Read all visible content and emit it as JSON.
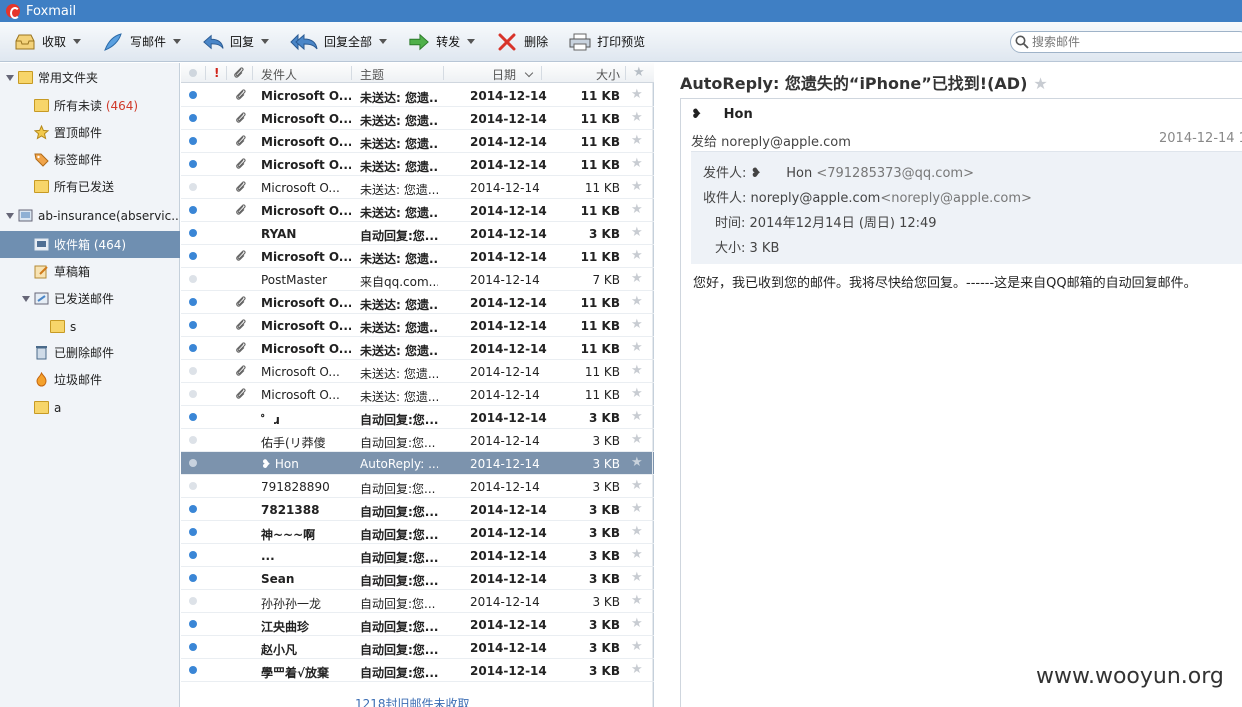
{
  "app": {
    "title": "Foxmail"
  },
  "toolbar": {
    "receive": "收取",
    "compose": "写邮件",
    "reply": "回复",
    "reply_all": "回复全部",
    "forward": "转发",
    "delete": "删除",
    "print_preview": "打印预览"
  },
  "search": {
    "placeholder": "搜索邮件"
  },
  "sidebar": {
    "common_folders": "常用文件夹",
    "all_unread": "所有未读",
    "all_unread_count": "(464)",
    "pinned": "置顶邮件",
    "tagged": "标签邮件",
    "all_sent": "所有已发送",
    "account": "ab-insurance(abservic...",
    "inbox": "收件箱 (464)",
    "drafts": "草稿箱",
    "sent": "已发送邮件",
    "sub_s": "s",
    "deleted": "已删除邮件",
    "junk": "垃圾邮件",
    "folder_a": "a"
  },
  "list": {
    "columns": {
      "sender": "发件人",
      "subject": "主题",
      "date": "日期",
      "size": "大小",
      "flag": "!"
    },
    "rows": [
      {
        "sender": "Microsoft O...",
        "subject": "未送达: 您遗...",
        "date": "2014-12-14",
        "size": "11 KB",
        "unread": true,
        "attach": true
      },
      {
        "sender": "Microsoft O...",
        "subject": "未送达: 您遗...",
        "date": "2014-12-14",
        "size": "11 KB",
        "unread": true,
        "attach": true
      },
      {
        "sender": "Microsoft O...",
        "subject": "未送达: 您遗...",
        "date": "2014-12-14",
        "size": "11 KB",
        "unread": true,
        "attach": true
      },
      {
        "sender": "Microsoft O...",
        "subject": "未送达: 您遗...",
        "date": "2014-12-14",
        "size": "11 KB",
        "unread": true,
        "attach": true
      },
      {
        "sender": "Microsoft O...",
        "subject": "未送达: 您遗...",
        "date": "2014-12-14",
        "size": "11 KB",
        "unread": false,
        "attach": true
      },
      {
        "sender": "Microsoft O...",
        "subject": "未送达: 您遗...",
        "date": "2014-12-14",
        "size": "11 KB",
        "unread": true,
        "attach": true
      },
      {
        "sender": "RYAN",
        "subject": "自动回复:您...",
        "date": "2014-12-14",
        "size": "3 KB",
        "unread": true,
        "attach": false
      },
      {
        "sender": "Microsoft O...",
        "subject": "未送达: 您遗...",
        "date": "2014-12-14",
        "size": "11 KB",
        "unread": true,
        "attach": true
      },
      {
        "sender": "PostMaster",
        "subject": "来自qq.com...",
        "date": "2014-12-14",
        "size": "7 KB",
        "unread": false,
        "attach": false
      },
      {
        "sender": "Microsoft O...",
        "subject": "未送达: 您遗...",
        "date": "2014-12-14",
        "size": "11 KB",
        "unread": true,
        "attach": true
      },
      {
        "sender": "Microsoft O...",
        "subject": "未送达: 您遗...",
        "date": "2014-12-14",
        "size": "11 KB",
        "unread": true,
        "attach": true
      },
      {
        "sender": "Microsoft O...",
        "subject": "未送达: 您遗...",
        "date": "2014-12-14",
        "size": "11 KB",
        "unread": true,
        "attach": true
      },
      {
        "sender": "Microsoft O...",
        "subject": "未送达: 您遗...",
        "date": "2014-12-14",
        "size": "11 KB",
        "unread": false,
        "attach": true
      },
      {
        "sender": "Microsoft O...",
        "subject": "未送达: 您遗...",
        "date": "2014-12-14",
        "size": "11 KB",
        "unread": false,
        "attach": true
      },
      {
        "sender": "゜ɹ",
        "subject": "自动回复:您...",
        "date": "2014-12-14",
        "size": "3 KB",
        "unread": true,
        "attach": false
      },
      {
        "sender": "佑手(リ莽傻",
        "subject": "自动回复:您...",
        "date": "2014-12-14",
        "size": "3 KB",
        "unread": false,
        "attach": false
      },
      {
        "sender": "❥       Hon",
        "subject": "AutoReply: ...",
        "date": "2014-12-14",
        "size": "3 KB",
        "unread": false,
        "attach": false,
        "selected": true
      },
      {
        "sender": "791828890",
        "subject": "自动回复:您...",
        "date": "2014-12-14",
        "size": "3 KB",
        "unread": false,
        "attach": false
      },
      {
        "sender": "7821388",
        "subject": "自动回复:您...",
        "date": "2014-12-14",
        "size": "3 KB",
        "unread": true,
        "attach": false
      },
      {
        "sender": "神~~~啊",
        "subject": "自动回复:您...",
        "date": "2014-12-14",
        "size": "3 KB",
        "unread": true,
        "attach": false
      },
      {
        "sender": "                    ...",
        "subject": "自动回复:您...",
        "date": "2014-12-14",
        "size": "3 KB",
        "unread": true,
        "attach": false
      },
      {
        "sender": "Sean",
        "subject": "自动回复:您...",
        "date": "2014-12-14",
        "size": "3 KB",
        "unread": true,
        "attach": false
      },
      {
        "sender": "孙孙孙一龙",
        "subject": "自动回复:您...",
        "date": "2014-12-14",
        "size": "3 KB",
        "unread": false,
        "attach": false
      },
      {
        "sender": "江央曲珍",
        "subject": "自动回复:您...",
        "date": "2014-12-14",
        "size": "3 KB",
        "unread": true,
        "attach": false
      },
      {
        "sender": "赵小凡",
        "subject": "自动回复:您...",
        "date": "2014-12-14",
        "size": "3 KB",
        "unread": true,
        "attach": false
      },
      {
        "sender": "學罒着√放棄",
        "subject": "自动回复:您...",
        "date": "2014-12-14",
        "size": "3 KB",
        "unread": true,
        "attach": false
      }
    ],
    "more_text": "1218封旧邮件未收取"
  },
  "reader": {
    "title": "AutoReply: 您遗失的“iPhone”已找到!(AD)",
    "from_name": "Hon",
    "to_line": "发给 noreply@apple.com",
    "date_short": "2014-12-14 1",
    "sender_label": "发件人:",
    "sender_name": "Hon",
    "sender_email": "<791285373@qq.com>",
    "recipient_label": "收件人:",
    "recipient_name": "noreply@apple.com",
    "recipient_email": "<noreply@apple.com>",
    "time_label": "时间:",
    "time_value": "2014年12月14日 (周日) 12:49",
    "size_label": "大小:",
    "size_value": "3 KB",
    "body": "您好，我已收到您的邮件。我将尽快给您回复。------这是来自QQ邮箱的自动回复邮件。"
  },
  "watermark": "www.wooyun.org",
  "colors": {
    "unread_dot": "#3a86d6",
    "read_dot": "#dde2e8",
    "selection": "#7c93ad",
    "titlebar": "#3f7fc4"
  }
}
